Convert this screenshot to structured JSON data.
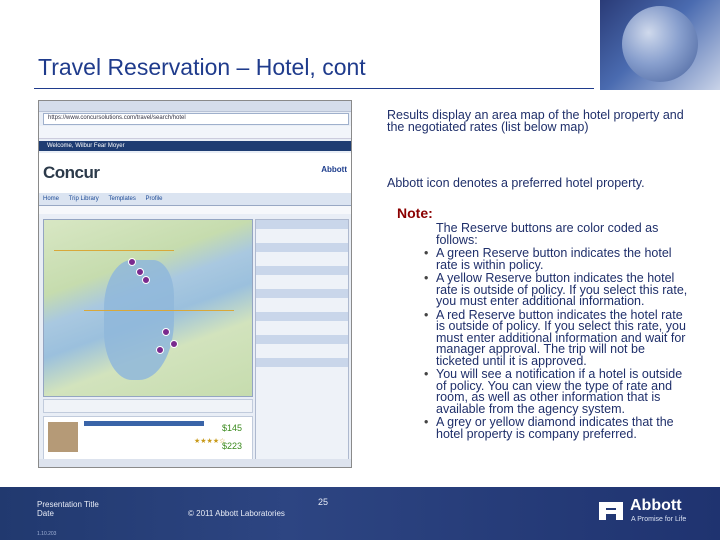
{
  "slide": {
    "title": "Travel Reservation – Hotel, cont"
  },
  "screenshot": {
    "address": "https://www.concursolutions.com/travel/search/hotel",
    "welcome": "Welcome, Wilbur Fear Moyer",
    "brand_left": "Concur",
    "brand_right": "Abbott",
    "tabs": [
      "Home",
      "Trip Library",
      "Templates",
      "Profile"
    ],
    "hotel_price_1": "$145",
    "hotel_price_2": "$223",
    "stars": "★★★★☆"
  },
  "content": {
    "paragraph1": "Results display an area map of the hotel property and the negotiated rates (list below map)",
    "paragraph2": "Abbott icon denotes a preferred hotel property.",
    "note_label": "Note:",
    "intro": "The Reserve buttons are color coded as follows:",
    "bullets": [
      "A green Reserve button indicates the hotel rate is within policy.",
      "A yellow Reserve button indicates the hotel rate is outside of policy. If you select this rate, you must enter additional information.",
      "A red Reserve button indicates the hotel rate is outside of policy. If you select this rate, you must enter additional information and wait for manager approval. The trip will not be ticketed until it is approved.",
      "You will see a notification if a hotel is outside of policy. You can view the type of rate and room, as well as other information that is available from the agency system.",
      "A grey or yellow diamond indicates that the hotel property is company preferred."
    ]
  },
  "footer": {
    "presentation_title": "Presentation Title",
    "date": "Date",
    "code": "1.10.203",
    "copyright": "© 2011 Abbott Laboratories",
    "page_number": "25",
    "brand": "Abbott",
    "tagline": "A Promise for Life"
  },
  "colors": {
    "title": "#1f3b8c",
    "note": "#8b0000",
    "footer_bg": "#2d4582"
  }
}
